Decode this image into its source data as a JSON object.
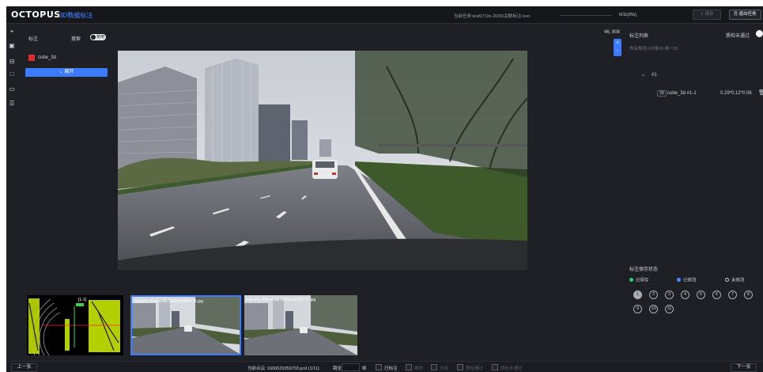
{
  "header": {
    "logo": "OCTOPUS",
    "title": "3D数据标注",
    "task_name": "当前任务:test0719z-2D3D关联标注-test",
    "progress": "0/11(0%)",
    "progress_fraction": 0.0,
    "save_label": "保存",
    "exit_label": "退出任务"
  },
  "toolbar": {
    "icons": [
      "cursor-icon",
      "box-icon",
      "folder-icon",
      "square-icon",
      "image-icon",
      "list-icon"
    ]
  },
  "left_panel": {
    "label_title": "标注",
    "search_label": "搜索",
    "toggle_text": "禁用",
    "class_name": "cube_3d",
    "class_color": "#e22b2b",
    "expand_label": "展开"
  },
  "viewer": {
    "coords": "46, 808",
    "zoom_in": "+",
    "zoom_out": "-"
  },
  "right_panel": {
    "title": "标注列表",
    "review_label": "质检未通过",
    "hint": "命名规则:#对象ID-唯一ID",
    "group": "#1",
    "object": {
      "badge": "3D",
      "name": "cube_3d #1-1",
      "size": "0.29*0.12*0.06"
    },
    "save_status_title": "标注保存状态",
    "legend": [
      {
        "label": "已保存",
        "color": "#2ecc71"
      },
      {
        "label": "已修改",
        "color": "#4a8cff"
      },
      {
        "label": "未修改",
        "color": "#ffffff"
      }
    ],
    "frames": [
      "1",
      "2",
      "3",
      "4",
      "5",
      "6",
      "7",
      "8",
      "9",
      "10",
      "11"
    ]
  },
  "thumbnails": {
    "pointcloud_tag": "[1-1]",
    "camera1": "camera_01encode-1606529359711.jpg",
    "camera3": "camera_03encode-1606529359721.jpg"
  },
  "footer": {
    "prev_label": "上一张",
    "next_label": "下一张",
    "current": "当前点云: 1606529359703.pcd (1/11)",
    "jump_label": "跳至",
    "frame_unit": "帧",
    "checkboxes": [
      {
        "label": "已标注",
        "color": "#cfd3da"
      },
      {
        "label": "难例",
        "color": "#5a5f69"
      },
      {
        "label": "无效",
        "color": "#5a5f69"
      },
      {
        "label": "质检通过",
        "color": "#5a5f69"
      },
      {
        "label": "质检未通过",
        "color": "#5a5f69"
      }
    ]
  }
}
